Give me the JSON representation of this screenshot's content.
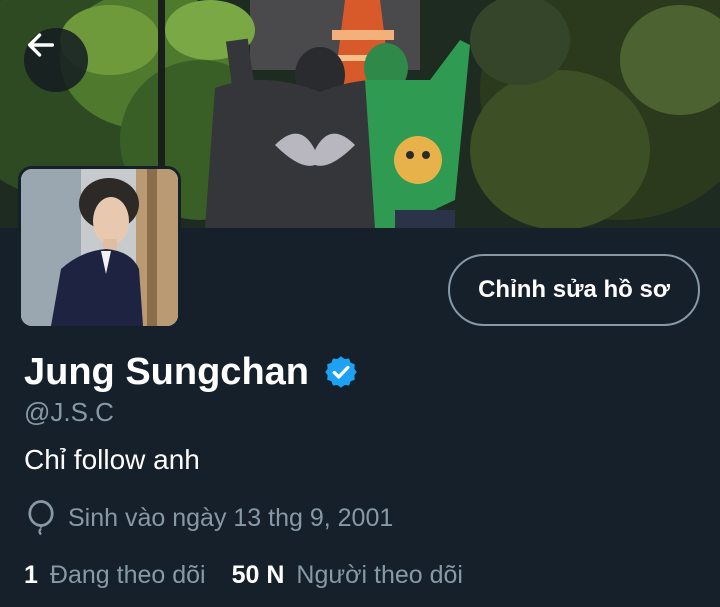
{
  "header": {
    "back_icon": "arrow-left-icon"
  },
  "profile": {
    "display_name": "Jung Sungchan",
    "verified_icon": "verified-badge-icon",
    "handle": "@J.S.C",
    "bio": "Chỉ follow anh",
    "birthday": "Sinh vào ngày 13 thg 9, 2001",
    "birthday_icon": "balloon-icon"
  },
  "actions": {
    "edit_profile_label": "Chỉnh sửa hồ sơ"
  },
  "stats": {
    "following_count": "1",
    "following_label": "Đang theo dõi",
    "followers_count": "50 N",
    "followers_label": "Người theo dõi"
  },
  "colors": {
    "background": "#15202b",
    "primary_text": "#ffffff",
    "secondary_text": "#8899a6",
    "verified": "#1da1f2",
    "button_border": "#8899a6"
  }
}
